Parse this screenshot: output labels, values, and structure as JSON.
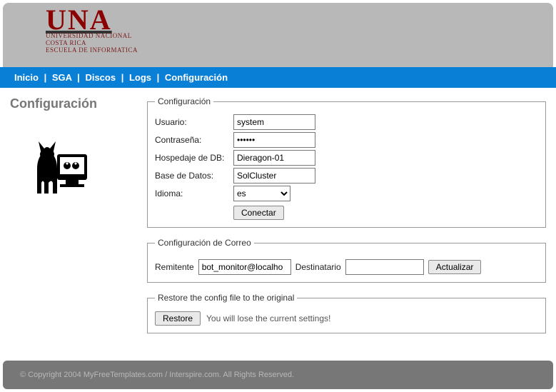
{
  "logo": {
    "main": "UNA",
    "line1": "UNIVERSIDAD NACIONAL",
    "line2": "COSTA RICA",
    "line3": "ESCUELA DE INFORMATICA"
  },
  "nav": {
    "inicio": "Inicio",
    "sga": "SGA",
    "discos": "Discos",
    "logs": "Logs",
    "config": "Configuración"
  },
  "page_title": "Configuración",
  "fs_config": {
    "legend": "Configuración",
    "usuario_label": "Usuario:",
    "usuario_value": "system",
    "pass_label": "Contraseña:",
    "pass_value": "••••••",
    "host_label": "Hospedaje de DB:",
    "host_value": "Dieragon-01",
    "db_label": "Base de Datos:",
    "db_value": "SolCluster",
    "idioma_label": "Idioma:",
    "idioma_value": "es",
    "connect_btn": "Conectar"
  },
  "fs_mail": {
    "legend": "Configuración de Correo",
    "remitente_label": "Remitente",
    "remitente_value": "bot_monitor@localho",
    "dest_label": "Destinatario",
    "dest_value": "",
    "update_btn": "Actualizar"
  },
  "fs_restore": {
    "legend": "Restore the config file to the original",
    "restore_btn": "Restore",
    "warn": "You will lose the current settings!"
  },
  "footer": "© Copyright 2004 MyFreeTemplates.com / Interspire.com. All Rights Reserved."
}
